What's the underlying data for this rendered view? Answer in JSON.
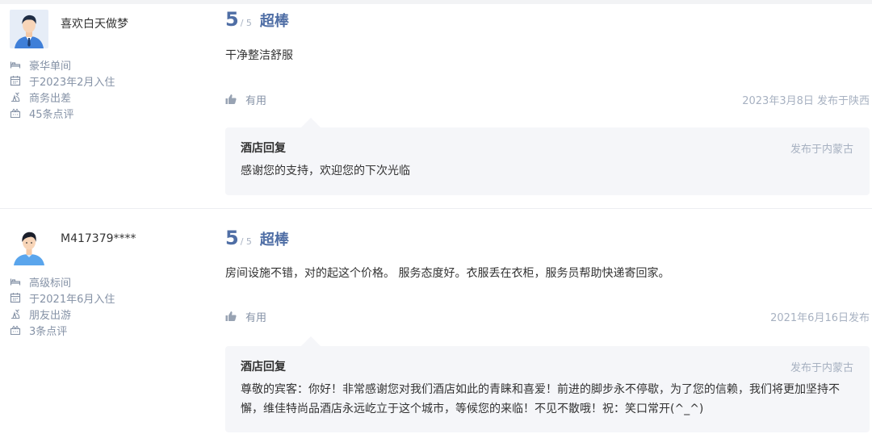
{
  "reviews": [
    {
      "user": {
        "name": "喜欢白天做梦",
        "avatar": "male-avatar",
        "room_type": "豪华单间",
        "stay_date": "于2023年2月入住",
        "trip_type": "商务出差",
        "review_count": "45条点评"
      },
      "score": "5",
      "score_total": "/ 5",
      "rating_word": "超棒",
      "comment": "干净整洁舒服",
      "helpful_label": "有用",
      "post_date": "2023年3月8日 发布于陕西",
      "reply": {
        "title": "酒店回复",
        "location": "发布于内蒙古",
        "text": "感谢您的支持，欢迎您的下次光临"
      }
    },
    {
      "user": {
        "name": "M417379****",
        "avatar": "male-avatar",
        "room_type": "高级标间",
        "stay_date": "于2021年6月入住",
        "trip_type": "朋友出游",
        "review_count": "3条点评"
      },
      "score": "5",
      "score_total": "/ 5",
      "rating_word": "超棒",
      "comment": "房间设施不错，对的起这个价格。 服务态度好。衣服丢在衣柜，服务员帮助快递寄回家。",
      "helpful_label": "有用",
      "post_date": "2021年6月16日发布",
      "reply": {
        "title": "酒店回复",
        "location": "发布于内蒙古",
        "text": "尊敬的宾客：你好！非常感谢您对我们酒店如此的青睐和喜爱！前进的脚步永不停歇，为了您的信赖，我们将更加坚持不懈，维佳特尚品酒店永远屹立于这个城市，等候您的来临！不见不散哦！祝：笑口常开(^_^)"
      }
    }
  ],
  "icons": {
    "room": "bed-icon",
    "date": "calendar-icon",
    "trip": "trip-type-icon",
    "reviews": "review-count-icon",
    "helpful": "thumbs-up-icon"
  },
  "colors": {
    "score": "#4f6ea5",
    "meta_text": "#8592a6",
    "reply_bg": "#f5f6f9"
  }
}
